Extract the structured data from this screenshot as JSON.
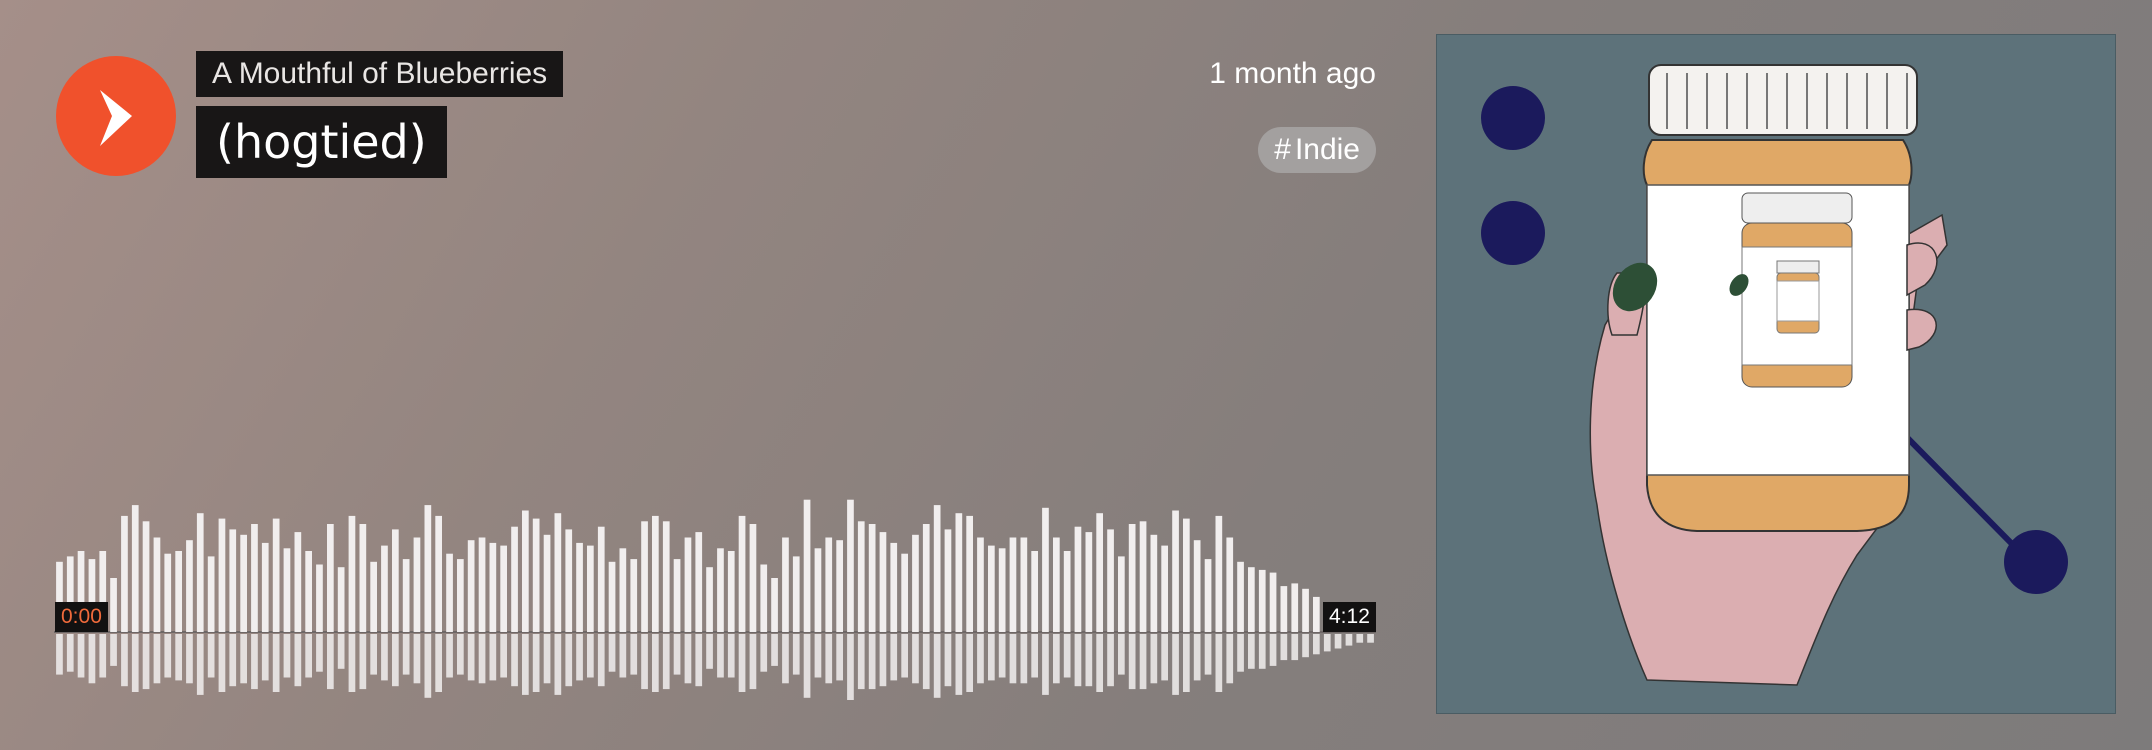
{
  "player": {
    "artist": "A Mouthful of Blueberries",
    "title": "(hogtied)",
    "posted": "1 month ago",
    "tag": {
      "hash": "#",
      "label": "Indie"
    },
    "time_current": "0:00",
    "time_total": "4:12",
    "play_icon": "play-icon"
  },
  "colors": {
    "accent": "#f0512c",
    "label_bg": "#181616",
    "waveform": "#f1eeee",
    "artwork_bg": "#5d727a",
    "navy": "#1b1a5c"
  },
  "waveform": {
    "progress": 0,
    "bars_top": [
      52,
      56,
      60,
      54,
      60,
      40,
      86,
      94,
      82,
      70,
      58,
      60,
      68,
      88,
      56,
      84,
      76,
      72,
      80,
      66,
      84,
      62,
      74,
      60,
      50,
      80,
      48,
      86,
      80,
      52,
      64,
      76,
      54,
      70,
      94,
      86,
      58,
      54,
      68,
      70,
      66,
      64,
      78,
      90,
      84,
      72,
      88,
      76,
      66,
      64,
      78,
      52,
      62,
      54,
      82,
      86,
      82,
      54,
      70,
      74,
      48,
      62,
      60,
      86,
      80,
      50,
      40,
      70,
      56,
      98,
      62,
      70,
      68,
      98,
      82,
      80,
      74,
      66,
      58,
      72,
      80,
      94,
      76,
      88,
      86,
      70,
      64,
      62,
      70,
      70,
      60,
      92,
      70,
      60,
      78,
      74,
      88,
      76,
      56,
      80,
      82,
      72,
      64,
      90,
      84,
      68,
      54,
      86,
      70,
      52,
      48,
      46,
      44,
      34,
      36,
      32,
      26,
      22,
      18,
      14,
      12,
      10
    ],
    "bars_bottom": [
      28,
      26,
      30,
      34,
      30,
      22,
      36,
      40,
      38,
      34,
      30,
      32,
      34,
      42,
      30,
      40,
      36,
      34,
      38,
      32,
      40,
      30,
      36,
      30,
      26,
      38,
      24,
      40,
      38,
      28,
      32,
      36,
      28,
      34,
      44,
      40,
      30,
      28,
      32,
      34,
      32,
      30,
      36,
      42,
      40,
      34,
      42,
      36,
      32,
      30,
      36,
      26,
      30,
      28,
      38,
      40,
      38,
      28,
      34,
      36,
      24,
      30,
      30,
      40,
      38,
      26,
      22,
      34,
      28,
      44,
      30,
      34,
      32,
      46,
      38,
      38,
      36,
      32,
      30,
      34,
      38,
      44,
      36,
      42,
      40,
      34,
      32,
      30,
      34,
      34,
      30,
      42,
      34,
      30,
      36,
      36,
      40,
      36,
      28,
      38,
      38,
      34,
      32,
      42,
      40,
      32,
      28,
      40,
      34,
      26,
      24,
      24,
      22,
      18,
      18,
      16,
      14,
      12,
      10,
      8,
      6,
      6
    ]
  }
}
